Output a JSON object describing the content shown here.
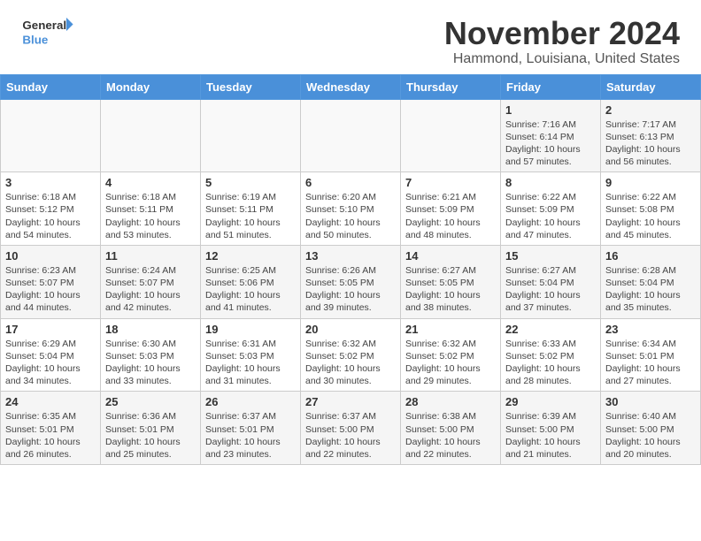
{
  "header": {
    "logo_line1": "General",
    "logo_line2": "Blue",
    "month": "November 2024",
    "location": "Hammond, Louisiana, United States"
  },
  "weekdays": [
    "Sunday",
    "Monday",
    "Tuesday",
    "Wednesday",
    "Thursday",
    "Friday",
    "Saturday"
  ],
  "weeks": [
    [
      {
        "day": "",
        "info": ""
      },
      {
        "day": "",
        "info": ""
      },
      {
        "day": "",
        "info": ""
      },
      {
        "day": "",
        "info": ""
      },
      {
        "day": "",
        "info": ""
      },
      {
        "day": "1",
        "info": "Sunrise: 7:16 AM\nSunset: 6:14 PM\nDaylight: 10 hours\nand 57 minutes."
      },
      {
        "day": "2",
        "info": "Sunrise: 7:17 AM\nSunset: 6:13 PM\nDaylight: 10 hours\nand 56 minutes."
      }
    ],
    [
      {
        "day": "3",
        "info": "Sunrise: 6:18 AM\nSunset: 5:12 PM\nDaylight: 10 hours\nand 54 minutes."
      },
      {
        "day": "4",
        "info": "Sunrise: 6:18 AM\nSunset: 5:11 PM\nDaylight: 10 hours\nand 53 minutes."
      },
      {
        "day": "5",
        "info": "Sunrise: 6:19 AM\nSunset: 5:11 PM\nDaylight: 10 hours\nand 51 minutes."
      },
      {
        "day": "6",
        "info": "Sunrise: 6:20 AM\nSunset: 5:10 PM\nDaylight: 10 hours\nand 50 minutes."
      },
      {
        "day": "7",
        "info": "Sunrise: 6:21 AM\nSunset: 5:09 PM\nDaylight: 10 hours\nand 48 minutes."
      },
      {
        "day": "8",
        "info": "Sunrise: 6:22 AM\nSunset: 5:09 PM\nDaylight: 10 hours\nand 47 minutes."
      },
      {
        "day": "9",
        "info": "Sunrise: 6:22 AM\nSunset: 5:08 PM\nDaylight: 10 hours\nand 45 minutes."
      }
    ],
    [
      {
        "day": "10",
        "info": "Sunrise: 6:23 AM\nSunset: 5:07 PM\nDaylight: 10 hours\nand 44 minutes."
      },
      {
        "day": "11",
        "info": "Sunrise: 6:24 AM\nSunset: 5:07 PM\nDaylight: 10 hours\nand 42 minutes."
      },
      {
        "day": "12",
        "info": "Sunrise: 6:25 AM\nSunset: 5:06 PM\nDaylight: 10 hours\nand 41 minutes."
      },
      {
        "day": "13",
        "info": "Sunrise: 6:26 AM\nSunset: 5:05 PM\nDaylight: 10 hours\nand 39 minutes."
      },
      {
        "day": "14",
        "info": "Sunrise: 6:27 AM\nSunset: 5:05 PM\nDaylight: 10 hours\nand 38 minutes."
      },
      {
        "day": "15",
        "info": "Sunrise: 6:27 AM\nSunset: 5:04 PM\nDaylight: 10 hours\nand 37 minutes."
      },
      {
        "day": "16",
        "info": "Sunrise: 6:28 AM\nSunset: 5:04 PM\nDaylight: 10 hours\nand 35 minutes."
      }
    ],
    [
      {
        "day": "17",
        "info": "Sunrise: 6:29 AM\nSunset: 5:04 PM\nDaylight: 10 hours\nand 34 minutes."
      },
      {
        "day": "18",
        "info": "Sunrise: 6:30 AM\nSunset: 5:03 PM\nDaylight: 10 hours\nand 33 minutes."
      },
      {
        "day": "19",
        "info": "Sunrise: 6:31 AM\nSunset: 5:03 PM\nDaylight: 10 hours\nand 31 minutes."
      },
      {
        "day": "20",
        "info": "Sunrise: 6:32 AM\nSunset: 5:02 PM\nDaylight: 10 hours\nand 30 minutes."
      },
      {
        "day": "21",
        "info": "Sunrise: 6:32 AM\nSunset: 5:02 PM\nDaylight: 10 hours\nand 29 minutes."
      },
      {
        "day": "22",
        "info": "Sunrise: 6:33 AM\nSunset: 5:02 PM\nDaylight: 10 hours\nand 28 minutes."
      },
      {
        "day": "23",
        "info": "Sunrise: 6:34 AM\nSunset: 5:01 PM\nDaylight: 10 hours\nand 27 minutes."
      }
    ],
    [
      {
        "day": "24",
        "info": "Sunrise: 6:35 AM\nSunset: 5:01 PM\nDaylight: 10 hours\nand 26 minutes."
      },
      {
        "day": "25",
        "info": "Sunrise: 6:36 AM\nSunset: 5:01 PM\nDaylight: 10 hours\nand 25 minutes."
      },
      {
        "day": "26",
        "info": "Sunrise: 6:37 AM\nSunset: 5:01 PM\nDaylight: 10 hours\nand 23 minutes."
      },
      {
        "day": "27",
        "info": "Sunrise: 6:37 AM\nSunset: 5:00 PM\nDaylight: 10 hours\nand 22 minutes."
      },
      {
        "day": "28",
        "info": "Sunrise: 6:38 AM\nSunset: 5:00 PM\nDaylight: 10 hours\nand 22 minutes."
      },
      {
        "day": "29",
        "info": "Sunrise: 6:39 AM\nSunset: 5:00 PM\nDaylight: 10 hours\nand 21 minutes."
      },
      {
        "day": "30",
        "info": "Sunrise: 6:40 AM\nSunset: 5:00 PM\nDaylight: 10 hours\nand 20 minutes."
      }
    ]
  ]
}
